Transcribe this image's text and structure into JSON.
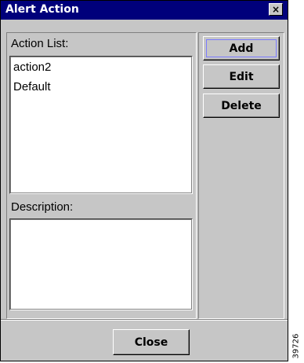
{
  "window": {
    "title": "Alert Action",
    "close_glyph": "×",
    "colors": {
      "titlebar": "#00007b",
      "face": "#c6c6c6",
      "focus": "#7b7bff"
    }
  },
  "action_list": {
    "label": "Action List:",
    "items": [
      "action2",
      "Default"
    ]
  },
  "description": {
    "label": "Description:",
    "value": ""
  },
  "buttons": {
    "add": "Add",
    "edit": "Edit",
    "delete": "Delete",
    "close": "Close"
  },
  "figure_id": "39726"
}
